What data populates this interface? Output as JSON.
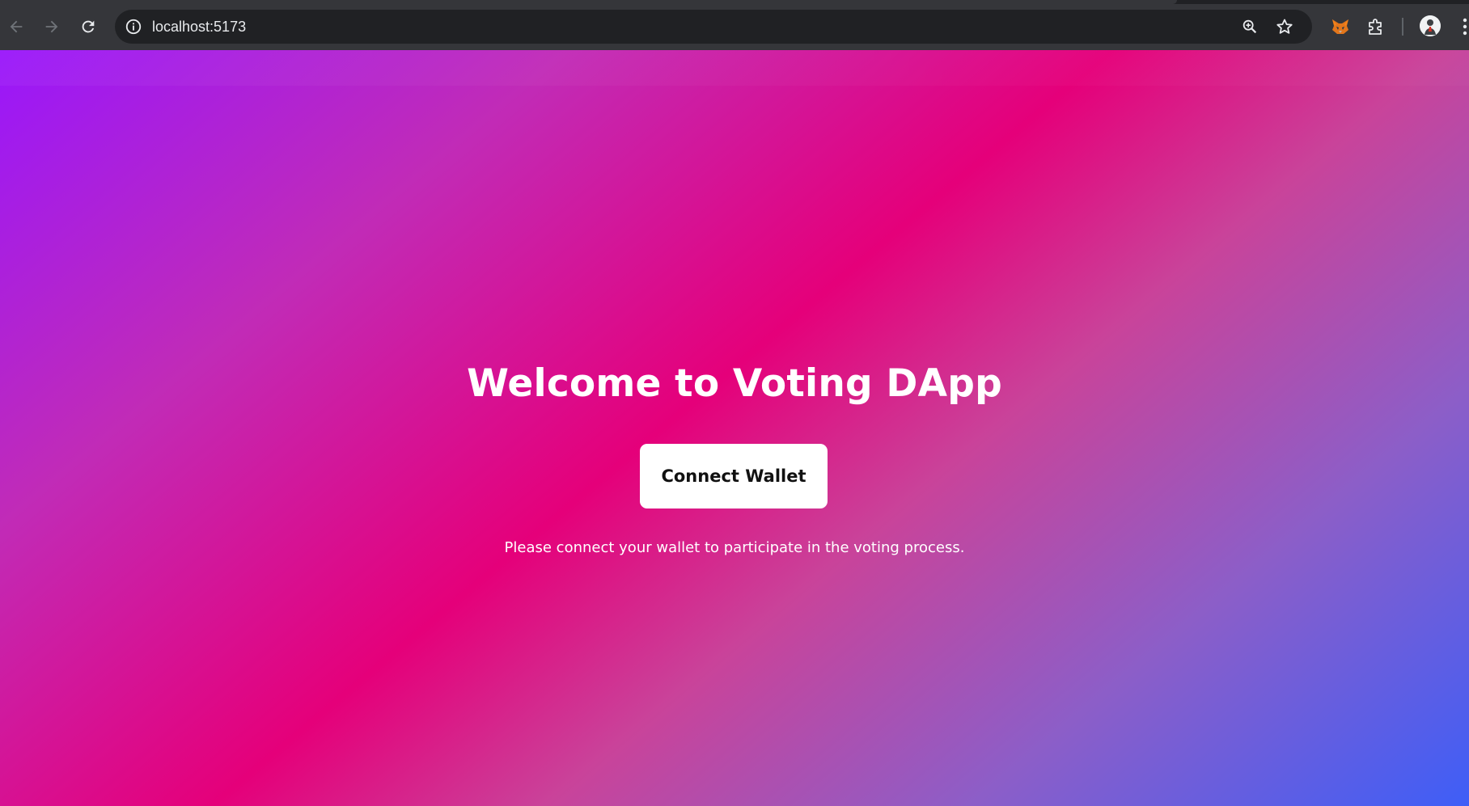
{
  "browser": {
    "url": "localhost:5173",
    "icons": {
      "back": "back-arrow-icon",
      "forward": "forward-arrow-icon",
      "reload": "reload-icon",
      "site_info": "info-icon",
      "zoom": "zoom-icon",
      "bookmark": "star-icon",
      "metamask": "fox-icon",
      "extensions": "puzzle-icon",
      "profile": "avatar",
      "menu": "more-vert-icon"
    },
    "colors": {
      "chrome_bg": "#35363a",
      "omnibox_bg": "#202124",
      "icon": "#e8eaed",
      "icon_disabled": "#6f7378"
    }
  },
  "page": {
    "title": "Welcome to Voting DApp",
    "connect_button_label": "Connect Wallet",
    "subtitle": "Please connect your wallet to participate in the voting process.",
    "colors": {
      "gradient_start": "#9917fb",
      "gradient_mid": "#e5007a",
      "gradient_end": "#3e5ef7",
      "text": "#ffffff",
      "button_bg": "#ffffff",
      "button_text": "#111111"
    }
  }
}
